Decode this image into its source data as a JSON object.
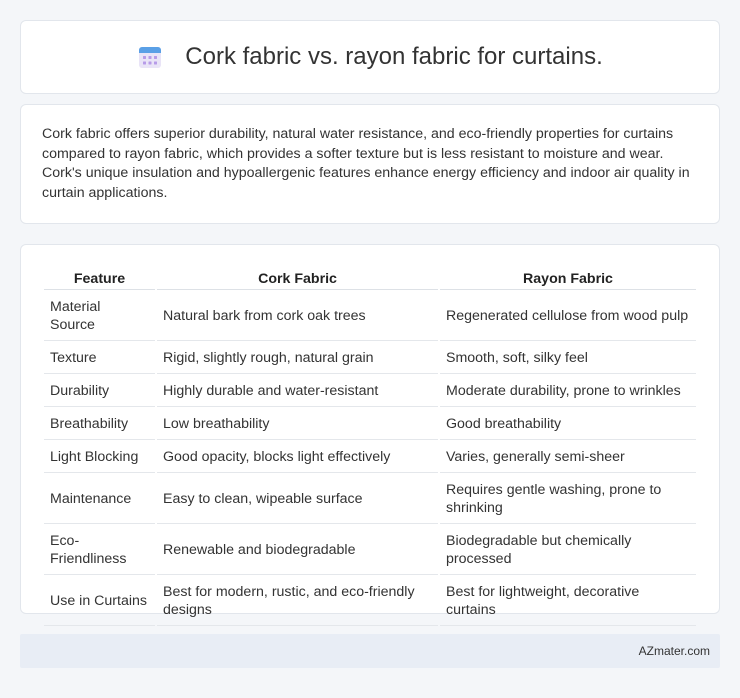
{
  "header": {
    "title": "Cork fabric vs. rayon fabric for curtains.",
    "icon": "calendar-icon"
  },
  "summary": {
    "text": "Cork fabric offers superior durability, natural water resistance, and eco-friendly properties for curtains compared to rayon fabric, which provides a softer texture but is less resistant to moisture and wear. Cork's unique insulation and hypoallergenic features enhance energy efficiency and indoor air quality in curtain applications."
  },
  "table": {
    "headers": [
      "Feature",
      "Cork Fabric",
      "Rayon Fabric"
    ],
    "rows": [
      [
        "Material Source",
        "Natural bark from cork oak trees",
        "Regenerated cellulose from wood pulp"
      ],
      [
        "Texture",
        "Rigid, slightly rough, natural grain",
        "Smooth, soft, silky feel"
      ],
      [
        "Durability",
        "Highly durable and water-resistant",
        "Moderate durability, prone to wrinkles"
      ],
      [
        "Breathability",
        "Low breathability",
        "Good breathability"
      ],
      [
        "Light Blocking",
        "Good opacity, blocks light effectively",
        "Varies, generally semi-sheer"
      ],
      [
        "Maintenance",
        "Easy to clean, wipeable surface",
        "Requires gentle washing, prone to shrinking"
      ],
      [
        "Eco-Friendliness",
        "Renewable and biodegradable",
        "Biodegradable but chemically processed"
      ],
      [
        "Use in Curtains",
        "Best for modern, rustic, and eco-friendly designs",
        "Best for lightweight, decorative curtains"
      ]
    ]
  },
  "footer": {
    "brand": "AZmater.com"
  }
}
